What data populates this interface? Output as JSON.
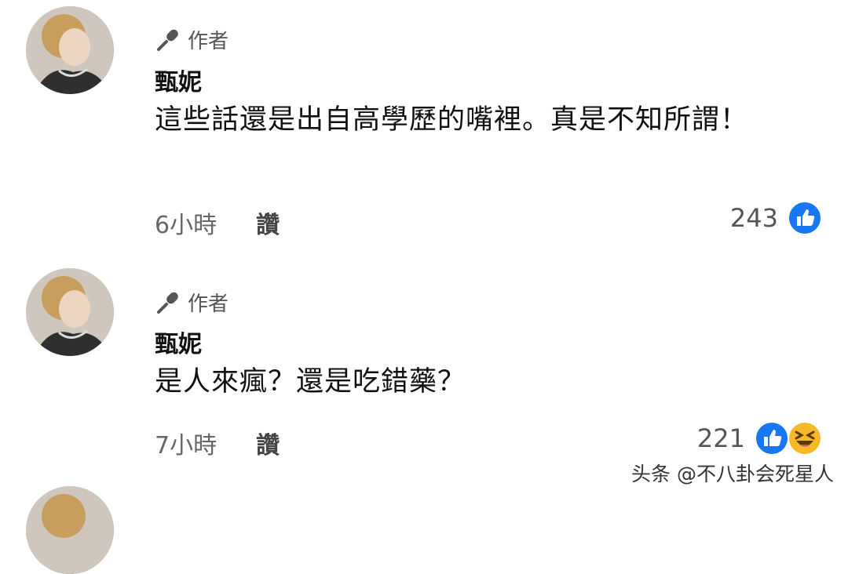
{
  "comments": [
    {
      "author_tag": "作者",
      "name": "甄妮",
      "text": "這些話還是出自高學歷的嘴裡。真是不知所謂！",
      "time": "6小時",
      "like_label": "讚",
      "reaction_count": "243",
      "reactions": [
        "like-icon"
      ]
    },
    {
      "author_tag": "作者",
      "name": "甄妮",
      "text": "是人來瘋？還是吃錯藥？",
      "time": "7小時",
      "like_label": "讚",
      "reaction_count": "221",
      "reactions": [
        "like-icon",
        "haha-icon"
      ]
    }
  ],
  "watermark": "头条 @不八卦会死星人",
  "colors": {
    "like_blue": "#1877f2",
    "haha_yellow": "#f7b928"
  }
}
